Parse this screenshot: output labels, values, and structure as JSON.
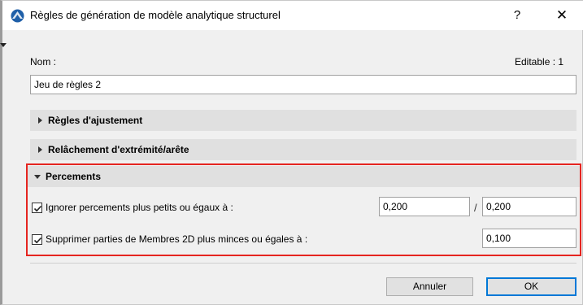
{
  "window": {
    "title": "Règles de génération de modèle analytique structurel",
    "help_glyph": "?",
    "close_glyph": "✕",
    "app_icon": "archicad-icon"
  },
  "name_field": {
    "label": "Nom :",
    "editable_text": "Editable : 1",
    "value": "Jeu de règles 2"
  },
  "sections": [
    {
      "label": "Règles d'ajustement",
      "expanded": false
    },
    {
      "label": "Relâchement d'extrémité/arête",
      "expanded": false
    },
    {
      "label": "Percements",
      "expanded": true
    }
  ],
  "openings": {
    "ignore": {
      "checked": true,
      "label": "Ignorer percements plus petits ou égaux à :",
      "value_1": "0,200",
      "separator": "/",
      "value_2": "0,200"
    },
    "remove": {
      "checked": true,
      "label": "Supprimer parties de Membres 2D plus minces ou égales à :",
      "value": "0,100"
    }
  },
  "buttons": {
    "cancel": "Annuler",
    "ok": "OK"
  },
  "colors": {
    "highlight": "#e52520",
    "section_bg": "#e0e0e0",
    "ok_border": "#0078d7"
  }
}
